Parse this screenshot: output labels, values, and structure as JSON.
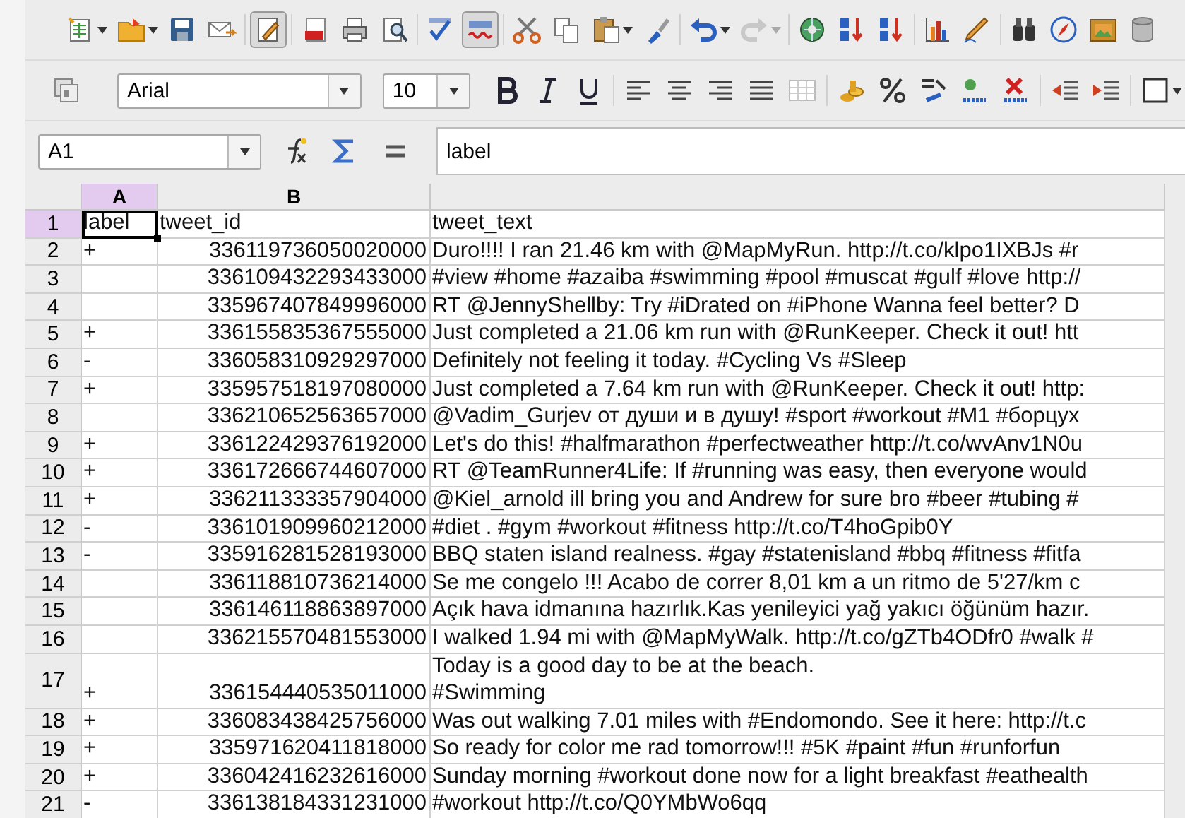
{
  "standard_toolbar": [
    {
      "pressed": false,
      "dropdown": true
    },
    {
      "pressed": false,
      "dropdown": true
    },
    {
      "pressed": false,
      "dropdown": false
    },
    {
      "pressed": false,
      "dropdown": false
    },
    {
      "pressed": true,
      "dropdown": false
    },
    {
      "pressed": false,
      "dropdown": false
    },
    {
      "pressed": false,
      "dropdown": false
    },
    {
      "pressed": false,
      "dropdown": false
    },
    {
      "pressed": false,
      "dropdown": false
    },
    {
      "pressed": true,
      "dropdown": false
    },
    {
      "pressed": false,
      "dropdown": false
    },
    {
      "pressed": false,
      "dropdown": false
    },
    {
      "pressed": false,
      "dropdown": true
    },
    {
      "pressed": false,
      "dropdown": false
    },
    {
      "pressed": false,
      "dropdown": true,
      "disabled": false
    },
    {
      "pressed": false,
      "dropdown": true,
      "disabled": true
    },
    {
      "pressed": false,
      "dropdown": false
    },
    {
      "pressed": false,
      "dropdown": false
    },
    {
      "pressed": false,
      "dropdown": false
    },
    {
      "pressed": false,
      "dropdown": false
    },
    {
      "pressed": false,
      "dropdown": false
    },
    {
      "pressed": false,
      "dropdown": false
    },
    {
      "pressed": false,
      "dropdown": false
    },
    {
      "pressed": false,
      "dropdown": false
    },
    {
      "pressed": false,
      "dropdown": false
    }
  ],
  "formatting_toolbar": {
    "font_name": "Arial",
    "font_size": "10"
  },
  "formula_bar": {
    "cell_reference": "A1",
    "content": "label"
  },
  "columns": [
    {
      "label": "A",
      "selected": true
    },
    {
      "label": "B",
      "selected": false
    },
    {
      "selected": false
    }
  ],
  "rows": [
    {
      "number": "1",
      "selected": true,
      "cells": [
        "label",
        "tweet_id",
        "tweet_text"
      ]
    },
    {
      "number": "2",
      "selected": false,
      "cells": [
        "+",
        "336119736050020000",
        "Duro!!!! I ran 21.46 km with @MapMyRun. http://t.co/klpo1IXBJs #r"
      ]
    },
    {
      "number": "3",
      "selected": false,
      "cells": [
        "",
        "336109432293433000",
        "#view #home #azaiba #swimming #pool #muscat #gulf #love http://"
      ]
    },
    {
      "number": "4",
      "selected": false,
      "cells": [
        "",
        "335967407849996000",
        "RT @JennyShellby: Try #iDrated on #iPhone Wanna feel better? D"
      ]
    },
    {
      "number": "5",
      "selected": false,
      "cells": [
        "+",
        "336155835367555000",
        "Just completed a 21.06 km run with @RunKeeper. Check it out! htt"
      ]
    },
    {
      "number": "6",
      "selected": false,
      "cells": [
        "-",
        "336058310929297000",
        "Definitely not feeling it today. #Cycling Vs #Sleep"
      ]
    },
    {
      "number": "7",
      "selected": false,
      "cells": [
        "+",
        "335957518197080000",
        "Just completed a 7.64 km run with @RunKeeper. Check it out! http:"
      ]
    },
    {
      "number": "8",
      "selected": false,
      "cells": [
        "",
        "336210652563657000",
        "@Vadim_Gurjev от души и в душу! #sport #workout #M1 #борцух"
      ]
    },
    {
      "number": "9",
      "selected": false,
      "cells": [
        "+",
        "336122429376192000",
        "Let's do this! #halfmarathon #perfectweather http://t.co/wvAnv1N0u"
      ]
    },
    {
      "number": "10",
      "selected": false,
      "cells": [
        "+",
        "336172666744607000",
        "RT @TeamRunner4Life: If #running was easy, then everyone would"
      ]
    },
    {
      "number": "11",
      "selected": false,
      "cells": [
        "+",
        "336211333357904000",
        "@Kiel_arnold ill bring you and Andrew for sure bro #beer #tubing #"
      ]
    },
    {
      "number": "12",
      "selected": false,
      "cells": [
        "-",
        "336101909960212000",
        "#diet . #gym #workout #fitness http://t.co/T4hoGpib0Y"
      ]
    },
    {
      "number": "13",
      "selected": false,
      "cells": [
        "-",
        "335916281528193000",
        "BBQ staten island realness. #gay #statenisland #bbq #fitness #fitfa"
      ]
    },
    {
      "number": "14",
      "selected": false,
      "cells": [
        "",
        "336118810736214000",
        "Se me congelo !!! Acabo de correr 8,01 km a un ritmo de 5'27/km c"
      ]
    },
    {
      "number": "15",
      "selected": false,
      "cells": [
        "",
        "336146118863897000",
        "Açık hava idmanına hazırlık.Kas yenileyici yağ yakıcı öğünüm hazır."
      ]
    },
    {
      "number": "16",
      "selected": false,
      "cells": [
        "",
        "336215570481553000",
        "I walked 1.94 mi with @MapMyWalk. http://t.co/gZTb4ODfr0 #walk #"
      ]
    },
    {
      "number": "17",
      "selected": false,
      "cells": [
        "+",
        "336154440535011000",
        "Today is a good day to be at the beach.\n#Swimming"
      ]
    },
    {
      "number": "18",
      "selected": false,
      "cells": [
        "+",
        "336083438425756000",
        "Was out walking 7.01 miles with #Endomondo. See it here: http://t.c"
      ]
    },
    {
      "number": "19",
      "selected": false,
      "cells": [
        "+",
        "335971620411818000",
        "So ready for color me rad tomorrow!!! #5K #paint #fun #runforfun"
      ]
    },
    {
      "number": "20",
      "selected": false,
      "cells": [
        "+",
        "336042416232616000",
        "Sunday morning #workout done now for a light breakfast #eathealth"
      ]
    },
    {
      "number": "21",
      "selected": false,
      "cells": [
        "-",
        "336138184331231000",
        "#workout http://t.co/Q0YMbWo6qq"
      ]
    }
  ]
}
